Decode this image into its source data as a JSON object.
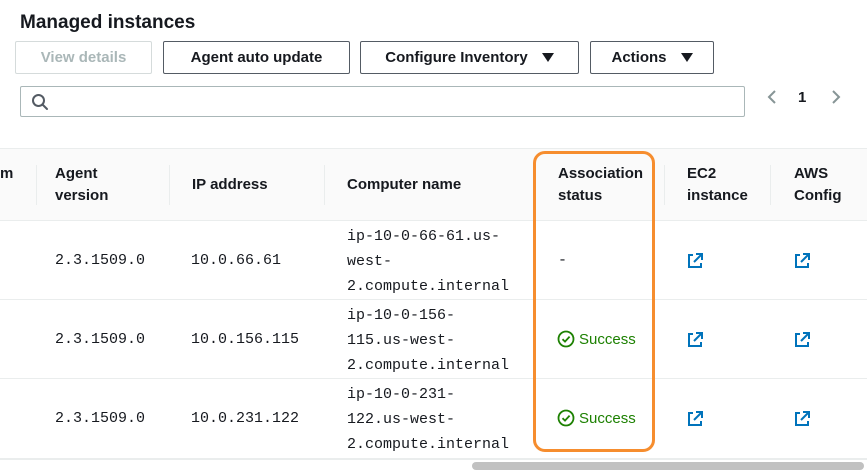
{
  "page": {
    "title": "Managed instances"
  },
  "toolbar": {
    "view_details": "View details",
    "agent_auto_update": "Agent auto update",
    "configure_inventory": "Configure Inventory",
    "actions": "Actions"
  },
  "search": {
    "value": "",
    "placeholder": ""
  },
  "pagination": {
    "current_page": "1"
  },
  "table": {
    "headers": {
      "partial_left": "m",
      "agent_version_1": "Agent",
      "agent_version_2": "version",
      "ip_address": "IP address",
      "computer_name": "Computer name",
      "association_status_1": "Association",
      "association_status_2": "status",
      "ec2_instance_1": "EC2",
      "ec2_instance_2": "instance",
      "aws_config_1": "AWS",
      "aws_config_2": "Config"
    },
    "rows": [
      {
        "agent_version": "2.3.1509.0",
        "ip_address": "10.0.66.61",
        "computer_name": [
          "ip-10-0-66-61.us-",
          "west-",
          "2.compute.internal"
        ],
        "association_status": "-"
      },
      {
        "agent_version": "2.3.1509.0",
        "ip_address": "10.0.156.115",
        "computer_name": [
          "ip-10-0-156-",
          "115.us-west-",
          "2.compute.internal"
        ],
        "association_status": "Success"
      },
      {
        "agent_version": "2.3.1509.0",
        "ip_address": "10.0.231.122",
        "computer_name": [
          "ip-10-0-231-",
          "122.us-west-",
          "2.compute.internal"
        ],
        "association_status": "Success"
      }
    ]
  },
  "colors": {
    "success": "#1d8102",
    "link": "#0073bb",
    "highlight": "#f68d2e"
  },
  "icons": [
    "search-icon",
    "chevron-left-icon",
    "chevron-right-icon",
    "caret-down-icon",
    "success-check-icon",
    "external-link-icon"
  ]
}
